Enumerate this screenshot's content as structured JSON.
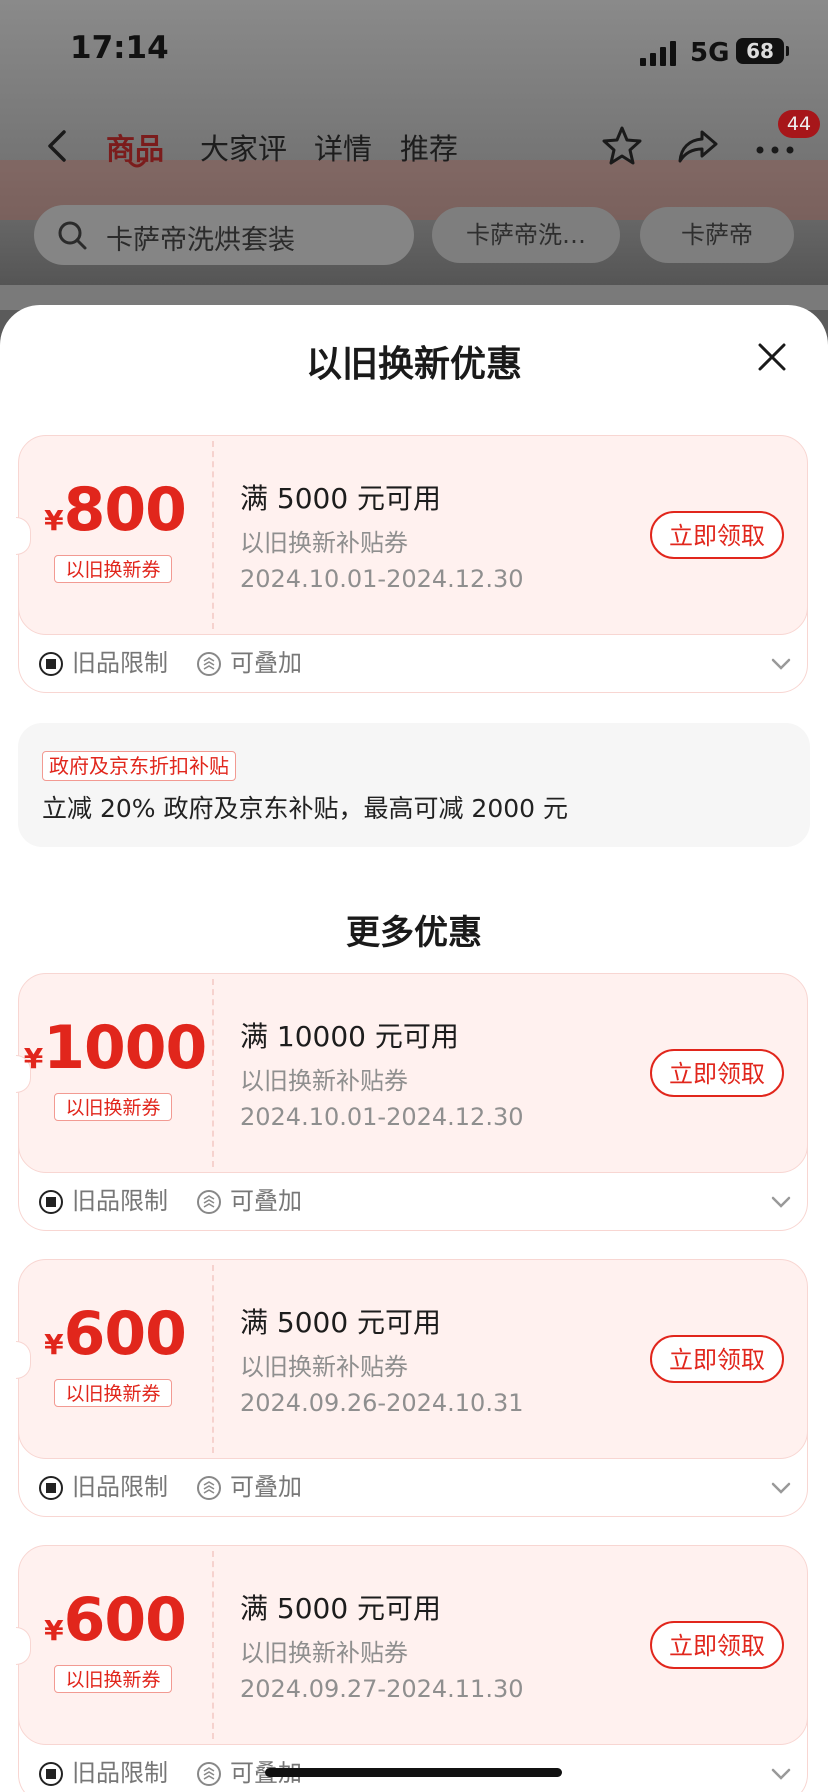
{
  "status": {
    "time": "17:14",
    "network": "5G",
    "battery": "68"
  },
  "nav": {
    "tabs": [
      "商品",
      "大家评",
      "详情",
      "推荐"
    ],
    "active_tab": 0,
    "badge": "44"
  },
  "search": {
    "query": "卡萨帝洗烘套装",
    "chips": [
      "卡萨帝洗…",
      "卡萨帝"
    ]
  },
  "sheet": {
    "title": "以旧换新优惠",
    "more_title": "更多优惠",
    "government": {
      "tag": "政府及京东折扣补贴",
      "text": "立减 20% 政府及京东补贴，最高可减 2000 元"
    },
    "coupons": [
      {
        "currency": "¥",
        "amount": "800",
        "tag": "以旧换新券",
        "condition": "满 5000 元可用",
        "type": "以旧换新补贴券",
        "date": "2024.10.01-2024.12.30",
        "button": "立即领取",
        "foot1": "旧品限制",
        "foot2": "可叠加"
      },
      {
        "currency": "¥",
        "amount": "1000",
        "tag": "以旧换新券",
        "condition": "满 10000 元可用",
        "type": "以旧换新补贴券",
        "date": "2024.10.01-2024.12.30",
        "button": "立即领取",
        "foot1": "旧品限制",
        "foot2": "可叠加"
      },
      {
        "currency": "¥",
        "amount": "600",
        "tag": "以旧换新券",
        "condition": "满 5000 元可用",
        "type": "以旧换新补贴券",
        "date": "2024.09.26-2024.10.31",
        "button": "立即领取",
        "foot1": "旧品限制",
        "foot2": "可叠加"
      },
      {
        "currency": "¥",
        "amount": "600",
        "tag": "以旧换新券",
        "condition": "满 5000 元可用",
        "type": "以旧换新补贴券",
        "date": "2024.09.27-2024.11.30",
        "button": "立即领取",
        "foot1": "旧品限制",
        "foot2": "可叠加"
      }
    ]
  },
  "colors": {
    "accent": "#e1261c",
    "coupon_bg": "#fff1ef"
  }
}
